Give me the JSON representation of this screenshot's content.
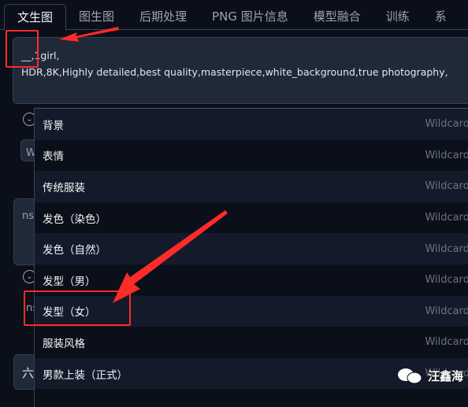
{
  "tabs": [
    "文生图",
    "图生图",
    "后期处理",
    "PNG 图片信息",
    "模型融合",
    "训练",
    "系"
  ],
  "prompt": {
    "value": "__,1girl,\nHDR,8K,Highly detailed,best quality,masterpiece,white_background,true photography,"
  },
  "left_partial": {
    "w": "W",
    "ns1": "ns",
    "ns2": "ns",
    "six": "六"
  },
  "dropdown": {
    "items": [
      {
        "label": "背景",
        "tag": "Wildcard"
      },
      {
        "label": "表情",
        "tag": "Wildcard"
      },
      {
        "label": "传统服装",
        "tag": "Wildcard"
      },
      {
        "label": "发色（染色）",
        "tag": "Wildcard"
      },
      {
        "label": "发色（自然）",
        "tag": "Wildcard"
      },
      {
        "label": "发型（男）",
        "tag": "Wildcard"
      },
      {
        "label": "发型（女）",
        "tag": "Wildcard"
      },
      {
        "label": "服装风格",
        "tag": "Wildcard"
      },
      {
        "label": "男款上装（正式）",
        "tag": "Wildcard"
      }
    ]
  },
  "watermark": "汪鑫海",
  "colors": {
    "annotation": "#ff2a2a",
    "background": "#0b0f19"
  }
}
